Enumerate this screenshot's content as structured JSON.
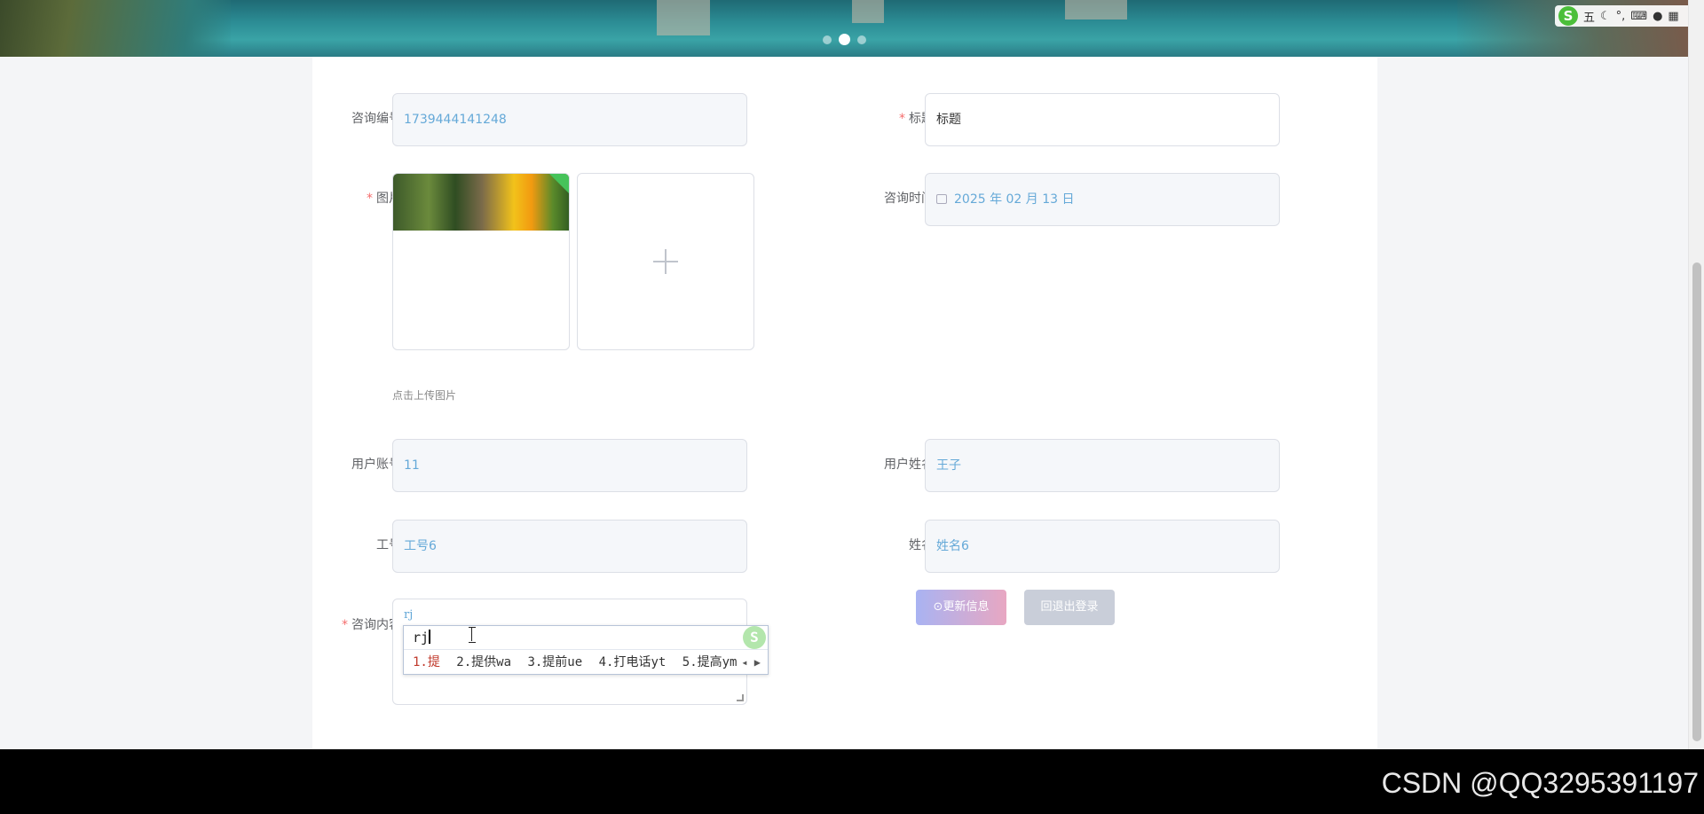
{
  "banner": {
    "slide_count": 3,
    "active_slide": 2
  },
  "ime_toolbar": {
    "logo": "S",
    "mode": "五",
    "icons": [
      "moon-icon",
      "punctuation-icon",
      "keyboard-icon",
      "user-icon",
      "grid-icon"
    ]
  },
  "form": {
    "consult_no": {
      "label": "咨询编号",
      "value": "1739444141248"
    },
    "title": {
      "label": "标题",
      "value": "标题",
      "required": true
    },
    "image": {
      "label": "图片",
      "required": true,
      "upload_tip": "点击上传图片"
    },
    "consult_time": {
      "label": "咨询时间",
      "value": "2025 年 02 月 13 日"
    },
    "user_account": {
      "label": "用户账号",
      "value": "11"
    },
    "user_name": {
      "label": "用户姓名",
      "value": "王子"
    },
    "work_no": {
      "label": "工号",
      "value": "工号6"
    },
    "name": {
      "label": "姓名",
      "value": "姓名6"
    },
    "content": {
      "label": "咨询内容",
      "value": "rj",
      "required": true
    }
  },
  "buttons": {
    "update": "⊙更新信息",
    "logout": "回退出登录"
  },
  "ime_popup": {
    "input": "rj",
    "candidates": [
      "1.提",
      "2.提供wa",
      "3.提前ue",
      "4.打电话yt",
      "5.提高ym"
    ]
  },
  "footer": {
    "watermark": "CSDN @QQ3295391197"
  },
  "colors": {
    "required": "#f56c6c",
    "value_text": "#65a9d8",
    "update_btn": "#a9b3f2",
    "logout_btn": "#c9ced9"
  }
}
